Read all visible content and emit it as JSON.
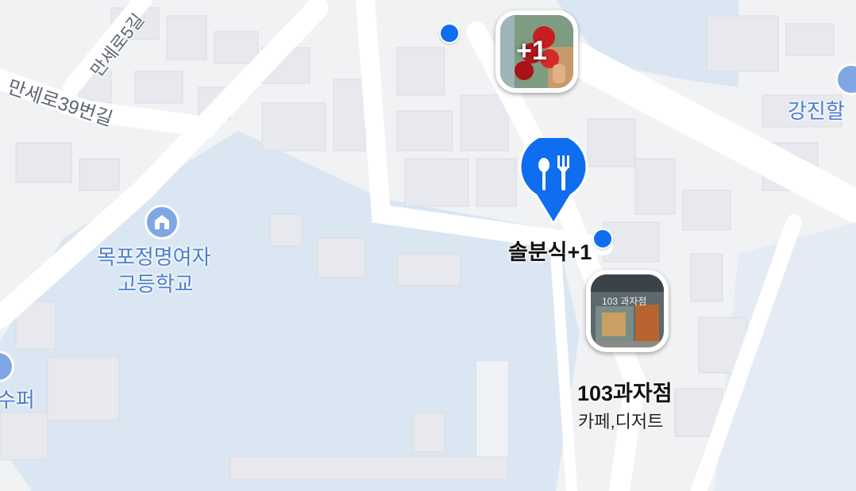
{
  "map": {
    "roads": {
      "road_5gil": "만세로5길",
      "road_39": "만세로39번길"
    },
    "places": {
      "school_line1": "목포정명여자",
      "school_line2": "고등학교",
      "gangjin": "강진할",
      "super": "수퍼"
    },
    "markers": {
      "cluster_badge": "+1",
      "restaurant_label": "솔분식+1",
      "bakery_name": "103과자점",
      "bakery_category": "카페,디저트",
      "bakery_sign": "103 과자점"
    },
    "colors": {
      "accent": "#0f6df0",
      "water_area": "#dbe6f3",
      "road": "#ffffff",
      "block": "#e9ebef"
    },
    "icons": {
      "restaurant": "fork-spoon-icon",
      "school": "school-icon"
    }
  }
}
